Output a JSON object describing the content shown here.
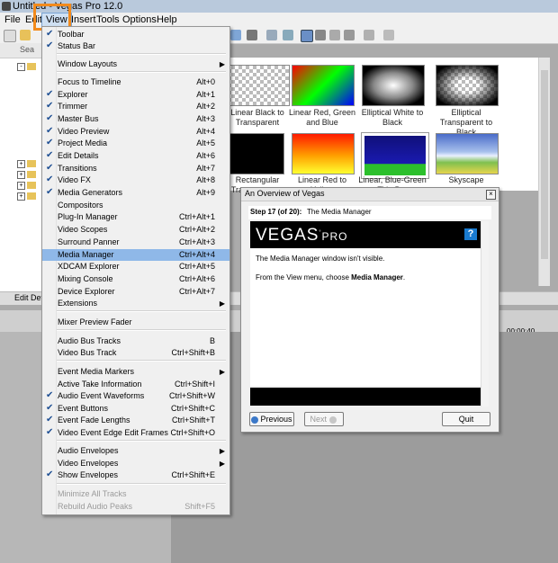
{
  "window": {
    "title": "Untitled - Vegas Pro 12.0"
  },
  "menubar": [
    "File",
    "Edit",
    "View",
    "Insert",
    "Tools",
    "Options",
    "Help"
  ],
  "explorer": {
    "search_label": "Sea",
    "tab_label": "Edit Deta"
  },
  "thumbnails": [
    {
      "label": "Linear Black to Transparent"
    },
    {
      "label": "Linear Red, Green and Blue"
    },
    {
      "label": "Elliptical White to Black"
    },
    {
      "label": "Elliptical Transparent to Black"
    },
    {
      "label": "Rectangular Transparent to Black"
    },
    {
      "label": "Linear Red to Yellow"
    },
    {
      "label": "Linear, Blue-Green Title Bar"
    },
    {
      "label": "Skyscape"
    }
  ],
  "timeline": {
    "time_marker": "00:00:40"
  },
  "view_menu": {
    "items": [
      {
        "label": "Toolbar",
        "shortcut": "",
        "checked": true
      },
      {
        "label": "Status Bar",
        "shortcut": "",
        "checked": true
      },
      {
        "label": "Window Layouts",
        "shortcut": "",
        "submenu": true
      },
      {
        "label": "Focus to Timeline",
        "shortcut": "Alt+0"
      },
      {
        "label": "Explorer",
        "shortcut": "Alt+1",
        "checked": true
      },
      {
        "label": "Trimmer",
        "shortcut": "Alt+2",
        "checked": true
      },
      {
        "label": "Master Bus",
        "shortcut": "Alt+3",
        "checked": true
      },
      {
        "label": "Video Preview",
        "shortcut": "Alt+4",
        "checked": true
      },
      {
        "label": "Project Media",
        "shortcut": "Alt+5",
        "checked": true
      },
      {
        "label": "Edit Details",
        "shortcut": "Alt+6",
        "checked": true
      },
      {
        "label": "Transitions",
        "shortcut": "Alt+7",
        "checked": true
      },
      {
        "label": "Video FX",
        "shortcut": "Alt+8",
        "checked": true
      },
      {
        "label": "Media Generators",
        "shortcut": "Alt+9",
        "checked": true
      },
      {
        "label": "Compositors",
        "shortcut": ""
      },
      {
        "label": "Plug-In Manager",
        "shortcut": "Ctrl+Alt+1"
      },
      {
        "label": "Video Scopes",
        "shortcut": "Ctrl+Alt+2"
      },
      {
        "label": "Surround Panner",
        "shortcut": "Ctrl+Alt+3"
      },
      {
        "label": "Media Manager",
        "shortcut": "Ctrl+Alt+4",
        "selected": true
      },
      {
        "label": "XDCAM Explorer",
        "shortcut": "Ctrl+Alt+5"
      },
      {
        "label": "Mixing Console",
        "shortcut": "Ctrl+Alt+6"
      },
      {
        "label": "Device Explorer",
        "shortcut": "Ctrl+Alt+7"
      },
      {
        "label": "Extensions",
        "shortcut": "",
        "submenu": true
      },
      {
        "label": "Mixer Preview Fader",
        "shortcut": ""
      },
      {
        "label": "Audio Bus Tracks",
        "shortcut": "B"
      },
      {
        "label": "Video Bus Track",
        "shortcut": "Ctrl+Shift+B"
      },
      {
        "label": "Event Media Markers",
        "shortcut": "",
        "submenu": true
      },
      {
        "label": "Active Take Information",
        "shortcut": "Ctrl+Shift+I"
      },
      {
        "label": "Audio Event Waveforms",
        "shortcut": "Ctrl+Shift+W",
        "checked": true
      },
      {
        "label": "Event Buttons",
        "shortcut": "Ctrl+Shift+C",
        "checked": true
      },
      {
        "label": "Event Fade Lengths",
        "shortcut": "Ctrl+Shift+T",
        "checked": true
      },
      {
        "label": "Video Event Edge Edit Frames",
        "shortcut": "Ctrl+Shift+O",
        "checked": true
      },
      {
        "label": "Audio Envelopes",
        "shortcut": "",
        "submenu": true
      },
      {
        "label": "Video Envelopes",
        "shortcut": "",
        "submenu": true
      },
      {
        "label": "Show Envelopes",
        "shortcut": "Ctrl+Shift+E",
        "checked": true
      },
      {
        "label": "Minimize All Tracks",
        "shortcut": "",
        "disabled": true
      },
      {
        "label": "Rebuild Audio Peaks",
        "shortcut": "Shift+F5",
        "disabled": true
      }
    ]
  },
  "dialog": {
    "title": "An Overview of Vegas",
    "step_prefix": "Step 17 (of 20):",
    "step_title": "The Media Manager",
    "logo": "VEGAS",
    "logo_suffix": "PRO",
    "help_label": "?",
    "line1": "The Media Manager window isn't visible.",
    "line2_prefix": "From the View menu, choose ",
    "line2_bold": "Media Manager",
    "line2_suffix": ".",
    "previous_label": "Previous",
    "next_label": "Next",
    "quit_label": "Quit"
  }
}
